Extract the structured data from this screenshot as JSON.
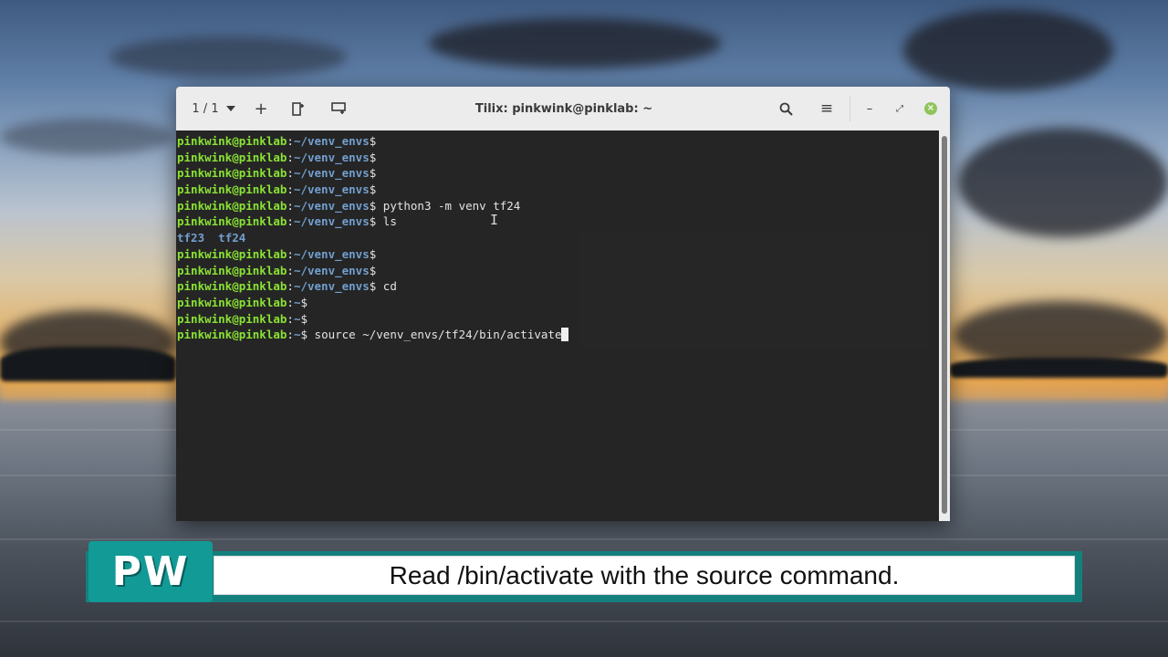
{
  "window": {
    "tab_counter": "1 / 1",
    "title": "Tilix: pinkwink@pinklab: ~",
    "icons": {
      "dropdown": "chevron-down-icon",
      "add": "plus-icon",
      "add_right": "split-right-icon",
      "add_down": "split-down-icon",
      "search": "search-icon",
      "menu": "hamburger-menu-icon",
      "minimize": "minimize-icon",
      "maximize": "maximize-icon",
      "close": "close-icon"
    },
    "glyphs": {
      "plus": "+",
      "menu": "≡",
      "minimize": "–",
      "maximize": "⤢",
      "close": "×"
    }
  },
  "terminal": {
    "lines": [
      {
        "user": "pinkwink@pinklab",
        "sep": ":",
        "path": "~/venv_envs",
        "prompt": "$",
        "cmd": ""
      },
      {
        "user": "pinkwink@pinklab",
        "sep": ":",
        "path": "~/venv_envs",
        "prompt": "$",
        "cmd": ""
      },
      {
        "user": "pinkwink@pinklab",
        "sep": ":",
        "path": "~/venv_envs",
        "prompt": "$",
        "cmd": ""
      },
      {
        "user": "pinkwink@pinklab",
        "sep": ":",
        "path": "~/venv_envs",
        "prompt": "$",
        "cmd": ""
      },
      {
        "user": "pinkwink@pinklab",
        "sep": ":",
        "path": "~/venv_envs",
        "prompt": "$",
        "cmd": " python3 -m venv tf24"
      },
      {
        "user": "pinkwink@pinklab",
        "sep": ":",
        "path": "~/venv_envs",
        "prompt": "$",
        "cmd": " ls"
      },
      {
        "output": [
          "tf23",
          "tf24"
        ]
      },
      {
        "user": "pinkwink@pinklab",
        "sep": ":",
        "path": "~/venv_envs",
        "prompt": "$",
        "cmd": ""
      },
      {
        "user": "pinkwink@pinklab",
        "sep": ":",
        "path": "~/venv_envs",
        "prompt": "$",
        "cmd": ""
      },
      {
        "user": "pinkwink@pinklab",
        "sep": ":",
        "path": "~/venv_envs",
        "prompt": "$",
        "cmd": " cd"
      },
      {
        "user": "pinkwink@pinklab",
        "sep": ":",
        "path": "~",
        "prompt": "$",
        "cmd": ""
      },
      {
        "user": "pinkwink@pinklab",
        "sep": ":",
        "path": "~",
        "prompt": "$",
        "cmd": ""
      },
      {
        "user": "pinkwink@pinklab",
        "sep": ":",
        "path": "~",
        "prompt": "$",
        "cmd": " source ~/venv_envs/tf24/bin/activate"
      }
    ],
    "ibeam": "I",
    "colors": {
      "user": "#8ae234",
      "path": "#729fcf",
      "text": "#e4e4e4",
      "background": "#262626"
    }
  },
  "caption": {
    "logo": "PW",
    "text": "Read /bin/activate with the source command.",
    "colors": {
      "banner": "#14807e",
      "logo": "#129a96"
    }
  }
}
